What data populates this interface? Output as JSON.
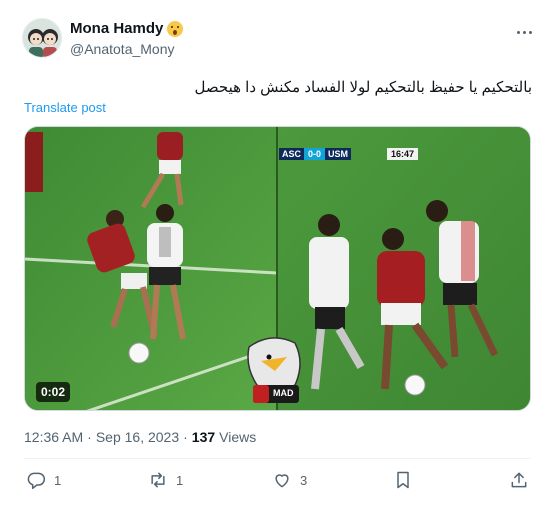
{
  "author": {
    "display_name": "Mona Hamdy",
    "handle": "@Anatota_Mony",
    "emoji": "hushed-face-emoji"
  },
  "tweet": {
    "text": "بالتحكيم يا حفيظ بالتحكيم لولا الفساد مكنش دا هيحصل",
    "translate_label": "Translate post"
  },
  "media": {
    "duration": "0:02",
    "scoreboard": {
      "home": "ASC",
      "score": "0-0",
      "away": "USM",
      "clock": "16:47"
    },
    "watermark": "MAD"
  },
  "meta": {
    "time": "12:36 AM",
    "separator": "·",
    "date": "Sep 16, 2023",
    "views_count": "137",
    "views_label": "Views"
  },
  "actions": {
    "replies": "1",
    "reposts": "1",
    "likes": "3"
  },
  "colors": {
    "link": "#1d9bf0",
    "secondary_text": "#536471",
    "pitch": "#4f9a3c"
  }
}
